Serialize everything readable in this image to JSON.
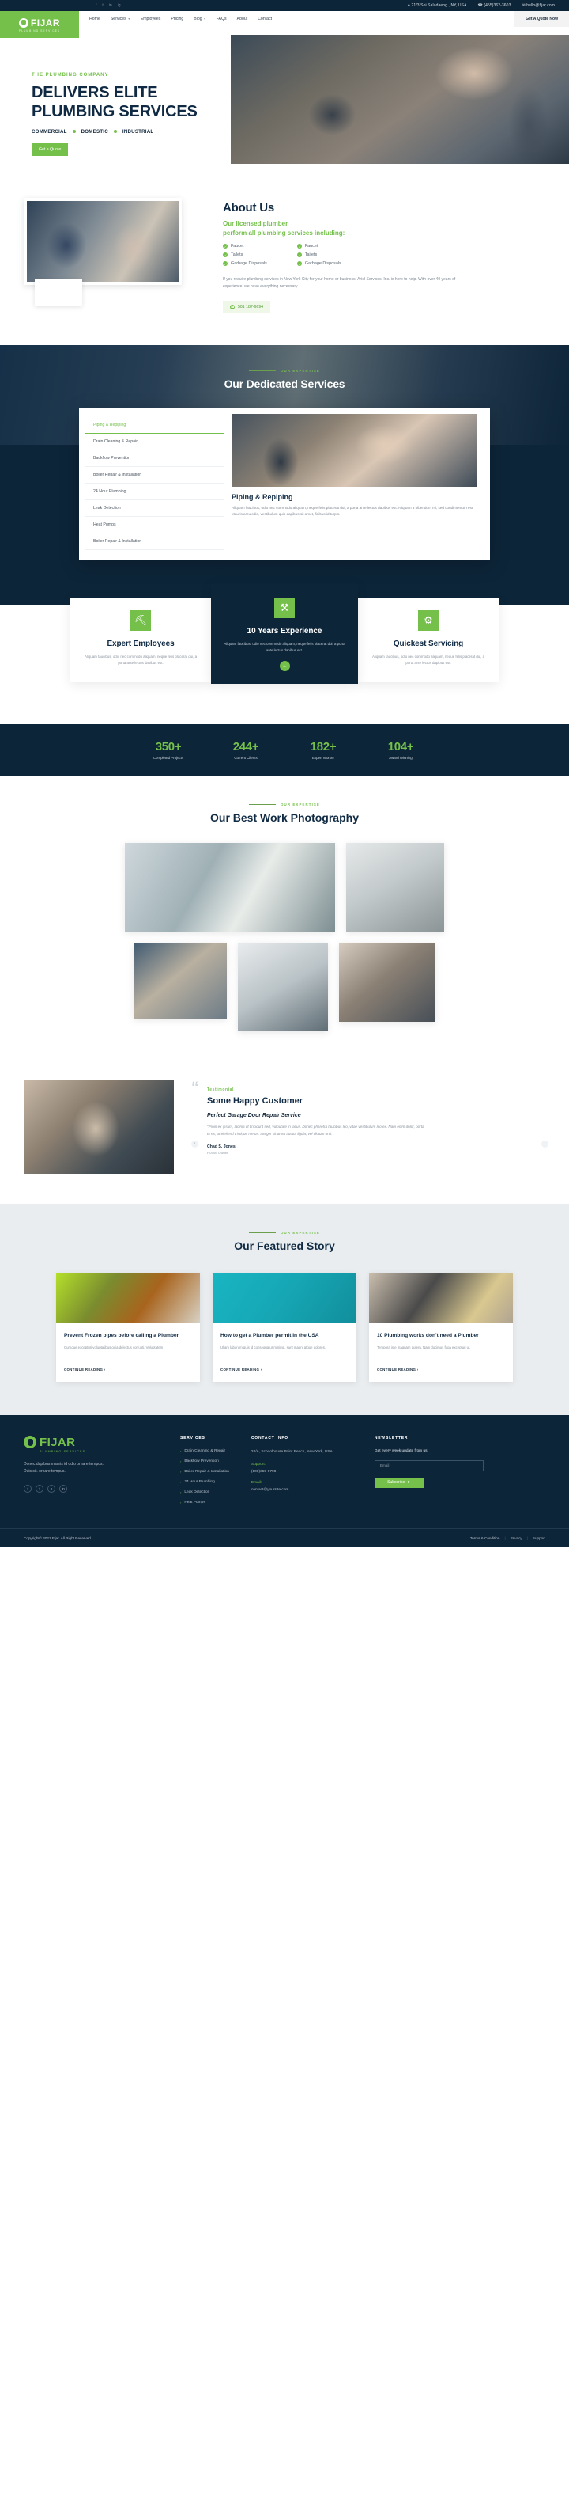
{
  "topbar": {
    "social": [
      "f",
      "t",
      "in",
      "ig"
    ],
    "address": "21/3 Soi Saladaeng , NY, USA",
    "phone": "(455)362-3603",
    "email": "hello@fijar.com",
    "location_icon": "map-pin-icon",
    "phone_icon": "phone-icon",
    "email_icon": "envelope-icon"
  },
  "brand": {
    "name": "FIJAR",
    "tagline": "PLUMBING SERVICES"
  },
  "nav": {
    "items": [
      {
        "label": "Home",
        "caret": false
      },
      {
        "label": "Services",
        "caret": true
      },
      {
        "label": "Employees",
        "caret": false
      },
      {
        "label": "Pricing",
        "caret": false
      },
      {
        "label": "Blog",
        "caret": true
      },
      {
        "label": "FAQs",
        "caret": false
      },
      {
        "label": "About",
        "caret": false
      },
      {
        "label": "Contact",
        "caret": false
      }
    ],
    "cta": "Get A Quote Now"
  },
  "hero": {
    "kicker": "THE PLUMBING COMPANY",
    "line1": "DELIVERS ELITE",
    "line2": "PLUMBING SERVICES",
    "tags": [
      "COMMERCIAL",
      "DOMESTIC",
      "INDUSTRIAL"
    ],
    "button": "Get a Quote"
  },
  "about": {
    "title": "About Us",
    "lead_line1": "Our licensed plumber",
    "lead_line2": "perform all plumbing services including:",
    "list_left": [
      "Faucet",
      "Tailets",
      "Garbage Disposals"
    ],
    "list_right": [
      "Faucet",
      "Tailets",
      "Garbage Disposals"
    ],
    "paragraph": "If you require plumbing services in New York City for your home or business, Ariel Services, Inc. is here to help. With over 40 years of experience, we have everything necessary.",
    "phone": "501 187-6694"
  },
  "services": {
    "eyebrow": "OUR EXPERTISE",
    "title": "Our Dedicated Services",
    "tabs": [
      "Piping & Repiping",
      "Drain Cleaning & Repair",
      "Backflow Prevention",
      "Boiler Repair & Installation",
      "24 Hour Plumbing",
      "Leak Detection",
      "Heat Pumps",
      "Boiler Repair & Installation"
    ],
    "active_tab": "Piping & Repiping",
    "pane_title": "Piping & Repiping",
    "pane_text": "Aliquam faucibus, odio nec commodo aliquam, neque felis placerat dui, a porta ante lectus dapibus est. Aliquam a bibendum mi, sed condimentum est. Mauris arcu odio, vestibulum quis dapibus sit amet, finibus id turpis."
  },
  "features": [
    {
      "icon": "worker-icon",
      "glyph": "⛏",
      "title": "Expert Employees",
      "text": "Aliquam faucibus, odio nec commodo aliquam, neque felis placerat dui, a porta ante lectus dapibus est.",
      "dark": false,
      "arrow": false
    },
    {
      "icon": "tools-icon",
      "glyph": "⚒",
      "title": "10 Years Experience",
      "text": "Aliquam faucibus, odio nec commodo aliquam, neque felis placerat dui, a porta ante lectus dapibus est.",
      "dark": true,
      "arrow": true,
      "arrow_glyph": "→"
    },
    {
      "icon": "speed-icon",
      "glyph": "⚙",
      "title": "Quickest Servicing",
      "text": "Aliquam faucibus, odio nec commodo aliquam, neque felis placerat dui, a porta ante lectus dapibus est.",
      "dark": false,
      "arrow": false
    }
  ],
  "stats": [
    {
      "num": "350+",
      "label": "Completed Projects"
    },
    {
      "num": "244+",
      "label": "Current Clients"
    },
    {
      "num": "182+",
      "label": "Expert Worker"
    },
    {
      "num": "104+",
      "label": "Award Winning"
    }
  ],
  "gallery": {
    "eyebrow": "OUR EXPERTISE",
    "title": "Our Best Work Photography",
    "tiles": [
      "bathroom-interior-photo",
      "tiled-wall-sink-photo",
      "plumber-under-sink-photo",
      "toilet-repair-photo",
      "drain-cleaning-photo"
    ]
  },
  "testimonial": {
    "label": "Testimonial",
    "heading": "Some Happy Customer",
    "subheading": "Perfect Garage Door Repair Service",
    "quote": "\"Proin ex ipsum, lacinia ut tincidunt sed, vulputate in lacus. Donec pharetra faucibus leo, vitae vestibulum leo ex. Nam enim dolor, porta et ex, ut eleifend tristique metus. Integer sit amet auctor ligula, vel dictum orci.\"",
    "author": "Chad S. Jones",
    "role": "House Owner",
    "prev_icon": "chevron-left-icon",
    "next_icon": "chevron-right-icon"
  },
  "blog": {
    "eyebrow": "OUR EXPERTISE",
    "title": "Our Featured Story",
    "posts": [
      {
        "image": "safety-vest-wrench-photo",
        "title": "Prevent Frozen pipes before calling a Plumber",
        "text": "Curnque excepturi voluptatibus quia delectus corrupti. Voluptatem",
        "link": "CONTINUE READING ›"
      },
      {
        "image": "tools-flatlay-photo",
        "title": "How to get a Plumber permit in the USA",
        "text": "Ullam laborum quis id consequatur minima. sunt magni atque dolores.",
        "link": "CONTINUE READING ›"
      },
      {
        "image": "plumber-working-photo",
        "title": "10 Plumbing works don't need a Plumber",
        "text": "Tempora iste magnam autem. Nam ducimus fuga excepturi ut.",
        "link": "CONTINUE READING ›"
      }
    ]
  },
  "footer": {
    "description": "Donec dapibus mauris id odio ornare tempus. Duis sit. ornare tempus.",
    "social": [
      "f",
      "t",
      "p",
      "in"
    ],
    "services_heading": "SERVICES",
    "services": [
      "Drain Cleaning & Repair",
      "Backflow Prevention",
      "Boiler Repair & Installation",
      "24 Hour Plumbing",
      "Leak Detection",
      "Heat Pumps"
    ],
    "contact_heading": "CONTACT INFO",
    "address": "24/A, Schoolhouse Point Beach, New York, USA",
    "support_label": "Support:",
    "support_value": "(100)359-0798",
    "email_label": "Email:",
    "email_value": "contact@yoursite.com",
    "newsletter_heading": "NEWSLETTER",
    "newsletter_text": "Get every week update from us",
    "email_placeholder": "Email",
    "subscribe": "Subscribe",
    "subscribe_icon": "paper-plane-icon",
    "copyright": "Copyright© 2021 Fijar. All Right Reserved.",
    "legal": [
      "Terms & Condition",
      "Privacy",
      "Support"
    ]
  },
  "colors": {
    "green": "#74c04a",
    "navy": "#0d2539",
    "dark_text": "#102a43"
  }
}
